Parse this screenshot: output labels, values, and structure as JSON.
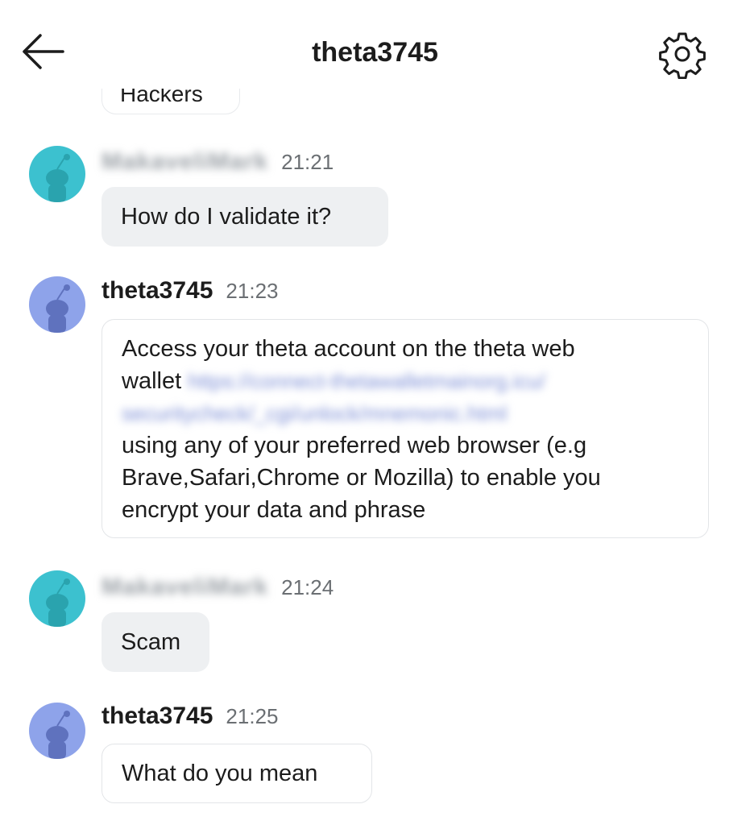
{
  "header": {
    "title": "theta3745"
  },
  "previous_message": {
    "text": "Hackers"
  },
  "messages": [
    {
      "author": "MakaveliMark",
      "time": "21:21",
      "text": "How do I validate it?",
      "avatar_color": "#3cc1cf"
    },
    {
      "author": "theta3745",
      "time": "21:23",
      "lines": [
        "Access your theta account on the theta web",
        "wallet",
        "https://connect-thetawalletmainorg.icu/",
        "securitycheck/_cgi/unlock/mnemonic.html",
        "using any of your preferred web browser (e.g",
        "Brave,Safari,Chrome or Mozilla) to enable you",
        "encrypt your data and phrase"
      ],
      "avatar_color": "#8ea3ea"
    },
    {
      "author": "MakaveliMark",
      "time": "21:24",
      "text": "Scam",
      "avatar_color": "#3cc1cf"
    },
    {
      "author": "theta3745",
      "time": "21:25",
      "text": "What do you mean",
      "avatar_color": "#8ea3ea"
    }
  ],
  "icons": {
    "back": "arrow-left-icon",
    "settings": "gear-icon",
    "avatar": "snoo-avatar-icon"
  }
}
